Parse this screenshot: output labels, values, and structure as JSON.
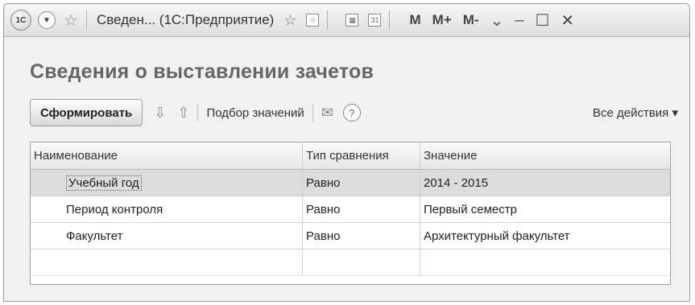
{
  "titlebar": {
    "title": "Сведен... (1С:Предприятие)",
    "m_label": "M",
    "mplus_label": "M+",
    "mminus_label": "M-",
    "logo_text": "1С"
  },
  "page": {
    "heading": "Сведения о выставлении зачетов"
  },
  "commandbar": {
    "generate_label": "Сформировать",
    "select_values_label": "Подбор значений",
    "help_label": "?",
    "all_actions_label": "Все действия ▾"
  },
  "table": {
    "columns": [
      "Наименование",
      "Тип сравнения",
      "Значение"
    ],
    "rows": [
      {
        "name": "Учебный год",
        "comparison": "Равно",
        "value": "2014 - 2015"
      },
      {
        "name": "Период контроля",
        "comparison": "Равно",
        "value": "Первый семестр"
      },
      {
        "name": "Факультет",
        "comparison": "Равно",
        "value": "Архитектурный факультет"
      }
    ]
  }
}
